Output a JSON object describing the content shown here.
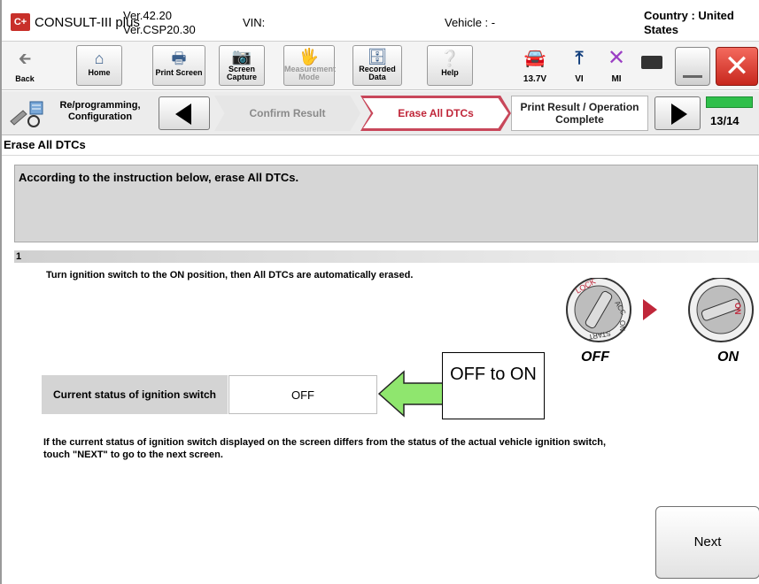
{
  "header": {
    "logo": "C+",
    "app_name": "CONSULT-III plus",
    "version_line1": "Ver.42.20",
    "version_line2": "Ver.CSP20.30",
    "vin_label": "VIN:",
    "vehicle_label": "Vehicle : -",
    "country_label": "Country : United States"
  },
  "toolbar": {
    "back_label": "Back",
    "home_label": "Home",
    "print_screen_label": "Print Screen",
    "screen_capture_label": "Screen Capture",
    "measurement_mode_label": "Measurement Mode",
    "recorded_data_label": "Recorded Data",
    "help_label": "Help",
    "voltage": "13.7V",
    "vi_label": "VI",
    "mi_label": "MI"
  },
  "stepnav": {
    "reprogramming_label": "Re/programming, Configuration",
    "step_confirm": "Confirm Result",
    "step_erase": "Erase All DTCs",
    "step_print": "Print Result / Operation Complete",
    "page_count": "13/14",
    "progress": 0.93
  },
  "main": {
    "section_title": "Erase All DTCs",
    "instruction": "According to the instruction below, erase All DTCs.",
    "step_number": "1",
    "step_text": "Turn ignition switch to the ON position, then All DTCs are automatically erased.",
    "status_label": "Current status of ignition switch",
    "status_value": "OFF",
    "callout_text": "OFF to ON",
    "footnote": "If the current status of ignition switch displayed on the screen differs from the status of the actual vehicle ignition switch, touch \"NEXT\" to go to the next screen.",
    "next_label": "Next"
  },
  "dials": {
    "off_label": "OFF",
    "on_label": "ON",
    "lock_label": "LOCK",
    "acc_label": "ACC",
    "on_small_label": "ON",
    "start_label": "START"
  },
  "colors": {
    "close_red": "#d63426",
    "active_step": "#c0273a",
    "progress_green": "#2fbf4a",
    "callout_arrow": "#8fe66e"
  }
}
